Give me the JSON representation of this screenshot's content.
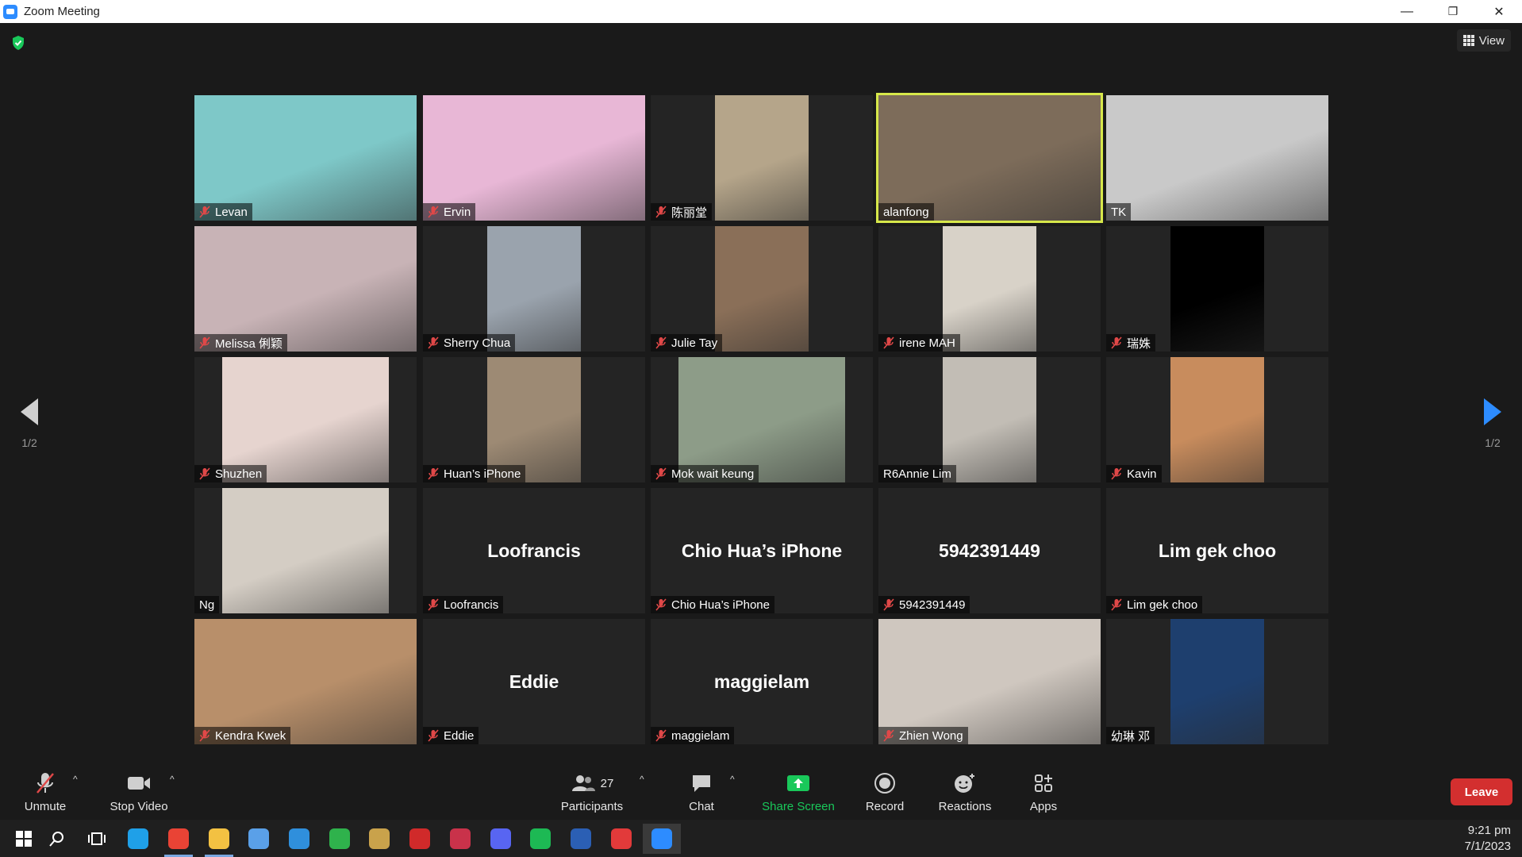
{
  "window": {
    "title": "Zoom Meeting",
    "minimize_glyph": "—",
    "restore_glyph": "❐",
    "close_glyph": "✕"
  },
  "header": {
    "security_icon": "shield-check-icon",
    "view_label": "View"
  },
  "pagination": {
    "left": "1/2",
    "right": "1/2"
  },
  "participants": [
    {
      "name": "Levan",
      "muted": true,
      "video": true,
      "bg": "#7ec8c8"
    },
    {
      "name": "Ervin",
      "muted": true,
      "video": true,
      "bg": "#e8b7d6"
    },
    {
      "name": "陈丽堂",
      "muted": true,
      "video": true,
      "bg": "#b5a58a"
    },
    {
      "name": "alanfong",
      "muted": false,
      "video": true,
      "bg": "#7d6c5a",
      "active": true
    },
    {
      "name": "TK",
      "muted": false,
      "video": true,
      "bg": "#c9c9c9"
    },
    {
      "name": "Melissa 俐颖",
      "muted": true,
      "video": true,
      "bg": "#c8b3b6"
    },
    {
      "name": "Sherry Chua",
      "muted": true,
      "video": true,
      "bg": "#9aa3ad"
    },
    {
      "name": "Julie Tay",
      "muted": true,
      "video": true,
      "bg": "#8a6f58"
    },
    {
      "name": "irene MAH",
      "muted": true,
      "video": true,
      "bg": "#d8d2c8"
    },
    {
      "name": "瑞姝",
      "muted": true,
      "video": true,
      "bg": "#000000"
    },
    {
      "name": "Shuzhen",
      "muted": true,
      "video": true,
      "bg": "#e6d4cf"
    },
    {
      "name": "Huan’s iPhone",
      "muted": true,
      "video": true,
      "bg": "#9d8a74"
    },
    {
      "name": "Mok wait keung",
      "muted": true,
      "video": true,
      "bg": "#8d9c88"
    },
    {
      "name": "R6Annie Lim",
      "muted": false,
      "video": true,
      "bg": "#c2bdb5"
    },
    {
      "name": "Kavin",
      "muted": true,
      "video": true,
      "bg": "#c88c5d"
    },
    {
      "name": "Ng",
      "muted": false,
      "video": true,
      "bg": "#d4cdc4"
    },
    {
      "name": "Loofrancis",
      "muted": true,
      "video": false
    },
    {
      "name": "Chio Hua’s iPhone",
      "muted": true,
      "video": false
    },
    {
      "name": "5942391449",
      "muted": true,
      "video": false
    },
    {
      "name": "Lim gek choo",
      "muted": true,
      "video": false
    },
    {
      "name": "Kendra Kwek",
      "muted": true,
      "video": true,
      "bg": "#b88f6a"
    },
    {
      "name": "Eddie",
      "muted": true,
      "video": false
    },
    {
      "name": "maggielam",
      "muted": true,
      "video": false
    },
    {
      "name": "Zhien Wong",
      "muted": true,
      "video": true,
      "bg": "#cfc7bf"
    },
    {
      "name": "幼琳 邓",
      "muted": false,
      "video": true,
      "bg": "#1e3f6e"
    }
  ],
  "toolbar": {
    "unmute": "Unmute",
    "stop_video": "Stop Video",
    "participants": "Participants",
    "participants_count": "27",
    "chat": "Chat",
    "share_screen": "Share Screen",
    "record": "Record",
    "reactions": "Reactions",
    "apps": "Apps",
    "leave": "Leave",
    "caret": "^"
  },
  "taskbar": {
    "apps": [
      "windows-start-icon",
      "search-icon",
      "task-view-icon",
      "edge-icon",
      "chrome-icon",
      "file-explorer-icon",
      "store-icon",
      "mail-icon",
      "xbox-icon",
      "league-icon",
      "garena-icon",
      "valorant-icon",
      "discord-icon",
      "spotify-icon",
      "word-icon",
      "music-icon",
      "zoom-icon"
    ],
    "time": "9:21 pm",
    "date": "7/1/2023"
  },
  "colors": {
    "accent_blue": "#2d8cff",
    "share_green": "#19c85a",
    "leave_red": "#d32f2f",
    "speaker_border": "#d7e84a",
    "mute_red": "#e04848"
  }
}
